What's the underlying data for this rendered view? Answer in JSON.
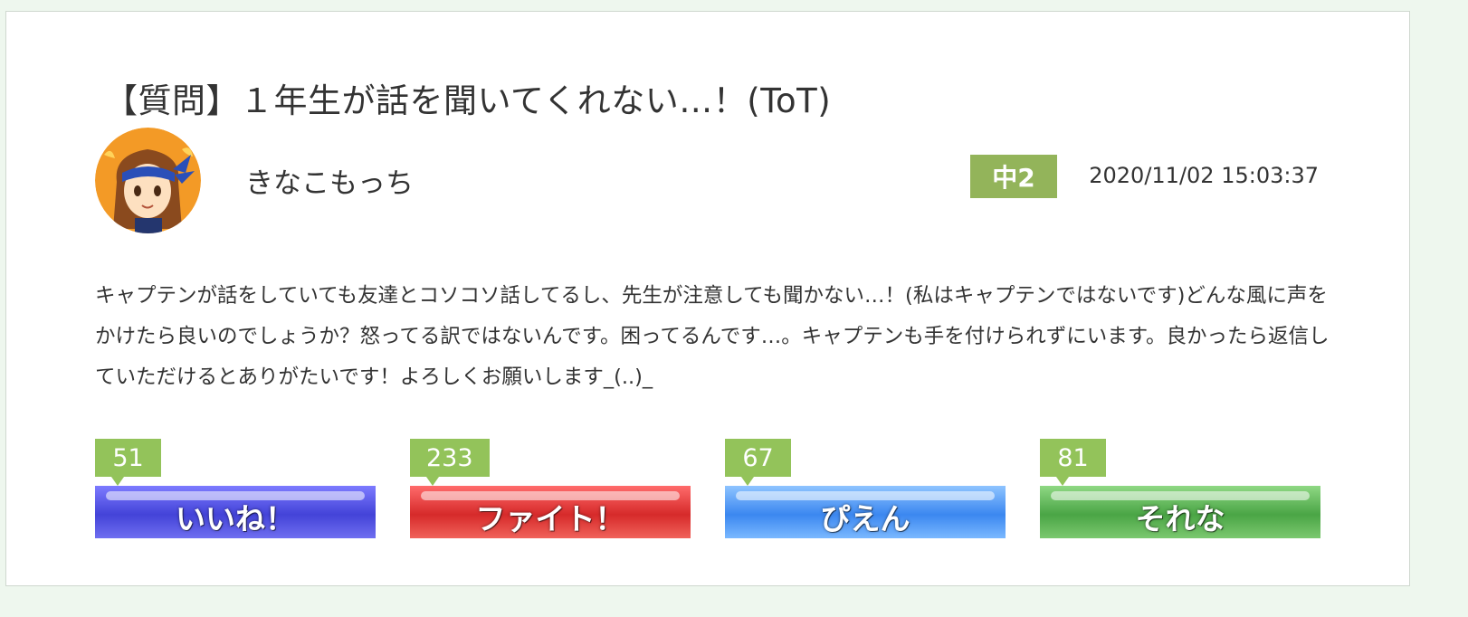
{
  "post": {
    "title": "【質問】１年生が話を聞いてくれない…！(ToT)",
    "author": "きなこもっち",
    "grade": "中2",
    "datetime": "2020/11/02 15:03:37",
    "body": "キャプテンが話をしていても友達とコソコソ話してるし、先生が注意しても聞かない…！(私はキャプテンではないです)どんな風に声をかけたら良いのでしょうか？怒ってる訳ではないんです。困ってるんです…。キャプテンも手を付けられずにいます。良かったら返信していただけるとありがたいです！よろしくお願いします_(..)_"
  },
  "reactions": [
    {
      "label": "いいね！",
      "count": "51"
    },
    {
      "label": "ファイト！",
      "count": "233"
    },
    {
      "label": "ぴえん",
      "count": "67"
    },
    {
      "label": "それな",
      "count": "81"
    }
  ],
  "colors": {
    "grade_badge": "#93b45a",
    "count_badge": "#93c35a",
    "like": "#4f4fe0",
    "fight": "#dd3333",
    "pien": "#4a92f4",
    "sore": "#55ad4d"
  },
  "icons": {
    "avatar": "girl-with-headband-avatar-icon"
  }
}
